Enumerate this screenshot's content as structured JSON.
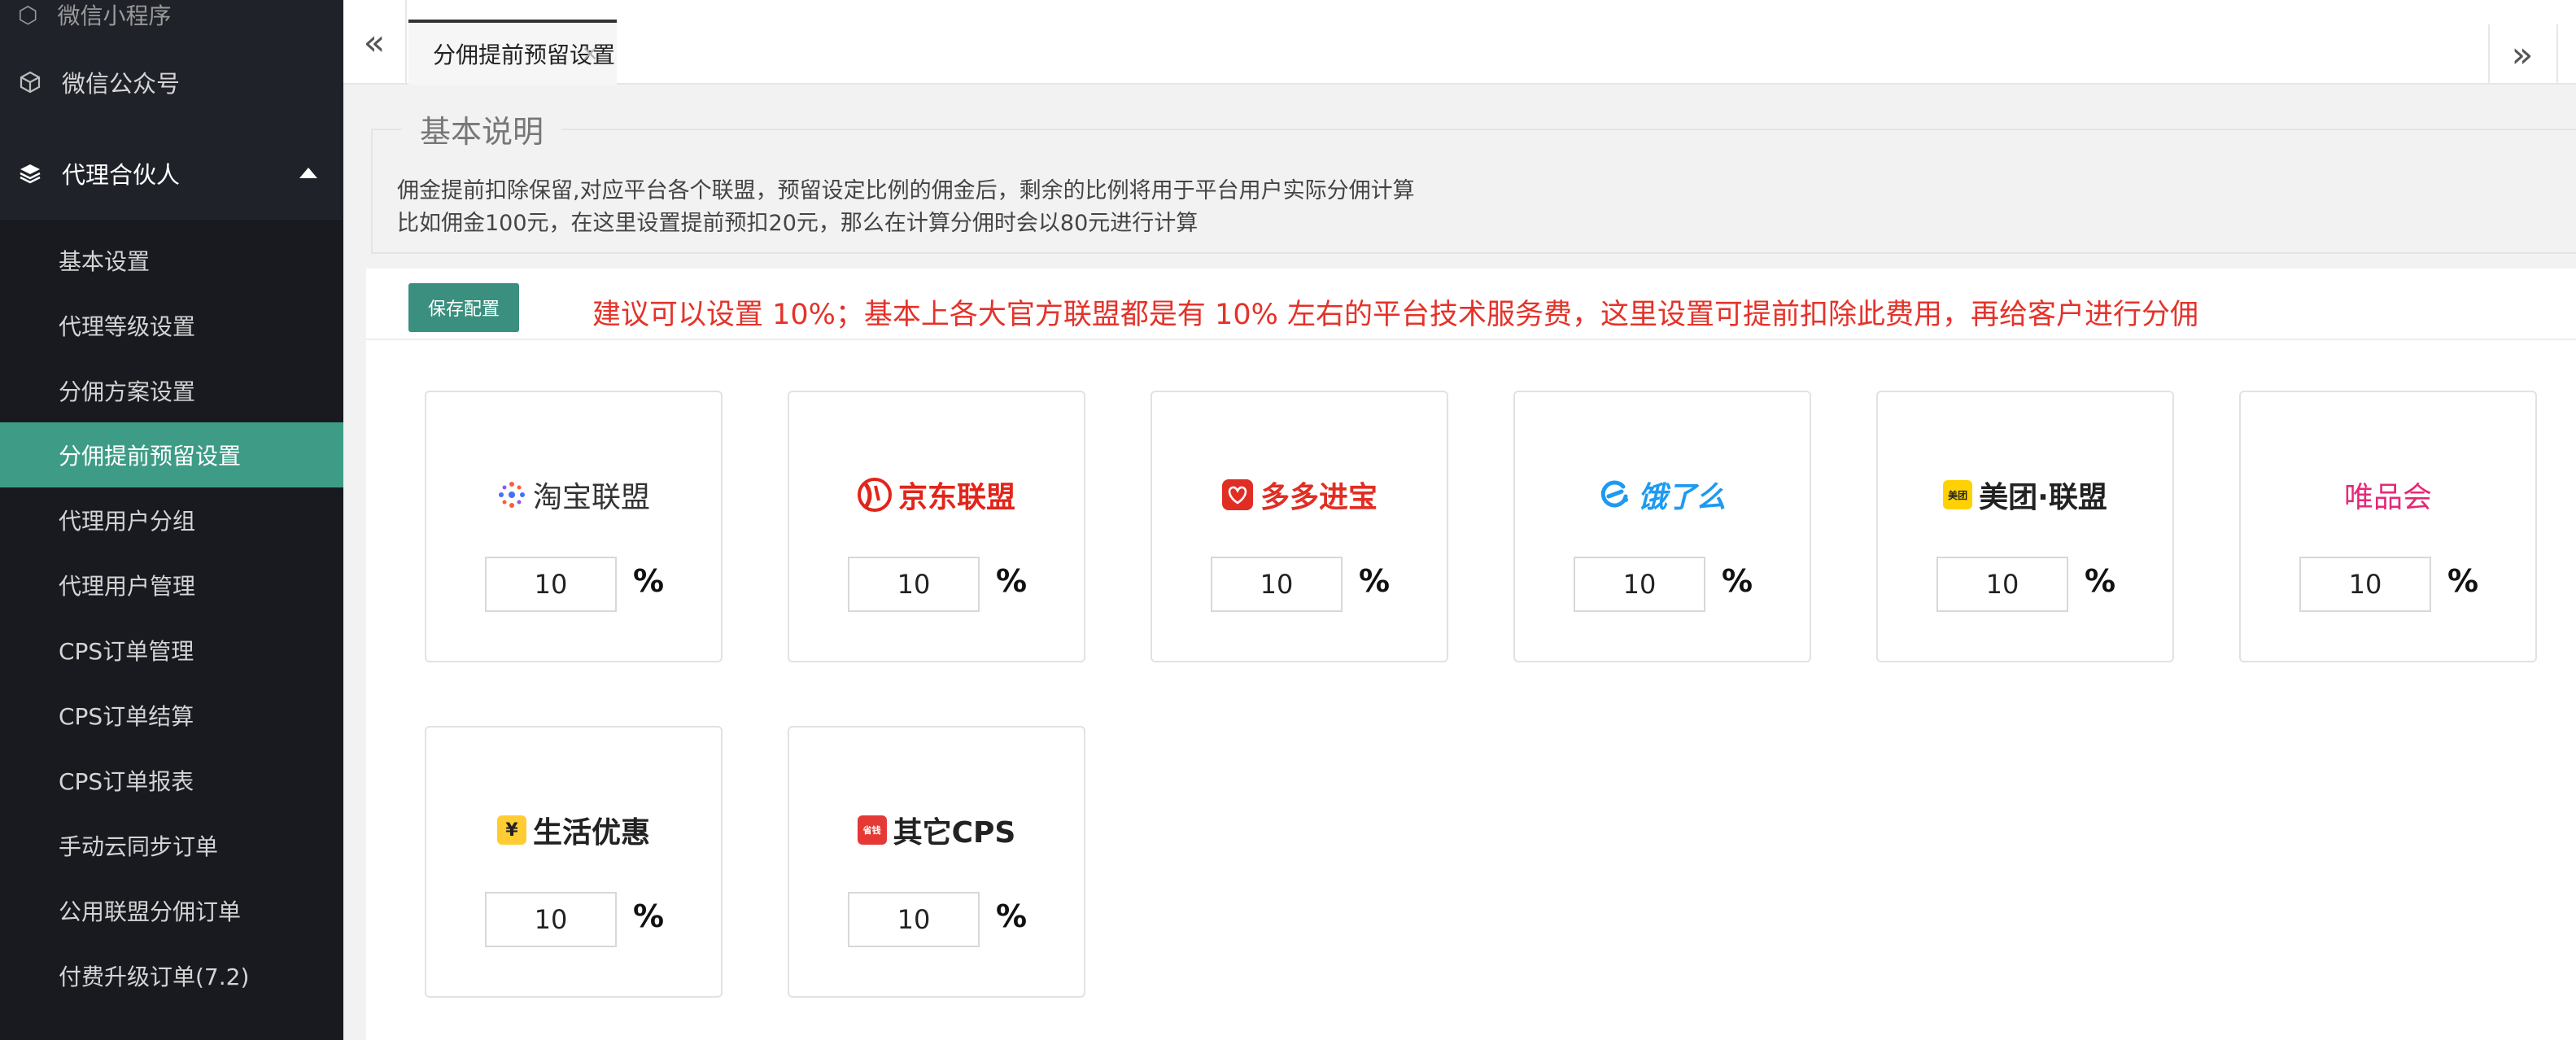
{
  "sidebar": {
    "top_cut_label": "微信小程序",
    "items": [
      {
        "label": "微信公众号"
      },
      {
        "label": "代理合伙人"
      }
    ],
    "sub_items": [
      {
        "label": "基本设置"
      },
      {
        "label": "代理等级设置"
      },
      {
        "label": "分佣方案设置"
      },
      {
        "label": "分佣提前预留设置"
      },
      {
        "label": "代理用户分组"
      },
      {
        "label": "代理用户管理"
      },
      {
        "label": "CPS订单管理"
      },
      {
        "label": "CPS订单结算"
      },
      {
        "label": "CPS订单报表"
      },
      {
        "label": "手动云同步订单"
      },
      {
        "label": "公用联盟分佣订单"
      },
      {
        "label": "付费升级订单(7.2)"
      }
    ]
  },
  "tabs": {
    "nav_left": "«",
    "nav_right": "»",
    "active_label": "分佣提前预留设置",
    "close": "×"
  },
  "intro": {
    "legend": "基本说明",
    "line1": "佣金提前扣除保留,对应平台各个联盟，预留设定比例的佣金后，剩余的比例将用于平台用户实际分佣计算",
    "line2": "比如佣金100元，在这里设置提前预扣20元，那么在计算分佣时会以80元进行计算"
  },
  "toolbar": {
    "save_label": "保存配置",
    "notice": "建议可以设置 10%；基本上各大官方联盟都是有 10% 左右的平台技术服务费，这里设置可提前扣除此费用，再给客户进行分佣"
  },
  "platforms": [
    {
      "name": "淘宝联盟",
      "rate": "10",
      "unit": "%",
      "color": "#333333",
      "mark_color": "#4a6cf7"
    },
    {
      "name": "京东联盟",
      "rate": "10",
      "unit": "%",
      "color": "#e1251b",
      "mark_color": "#e1251b"
    },
    {
      "name": "多多进宝",
      "rate": "10",
      "unit": "%",
      "color": "#e02e24",
      "mark_color": "#e02e24"
    },
    {
      "name": "饿了么",
      "rate": "10",
      "unit": "%",
      "color": "#1e9bf0",
      "mark_color": "#1e9bf0"
    },
    {
      "name": "美团·联盟",
      "rate": "10",
      "unit": "%",
      "color": "#222222",
      "mark_color": "#ffd100",
      "mark_text": "美团"
    },
    {
      "name": "唯品会",
      "rate": "10",
      "unit": "%",
      "color": "#e6287a",
      "mark_color": "#e6287a"
    },
    {
      "name": "生活优惠",
      "rate": "10",
      "unit": "%",
      "color": "#222222",
      "mark_color": "#ffcc33",
      "mark_text": "¥"
    },
    {
      "name": "其它CPS",
      "rate": "10",
      "unit": "%",
      "color": "#222222",
      "mark_color": "#e53935",
      "mark_text": "省钱"
    }
  ]
}
